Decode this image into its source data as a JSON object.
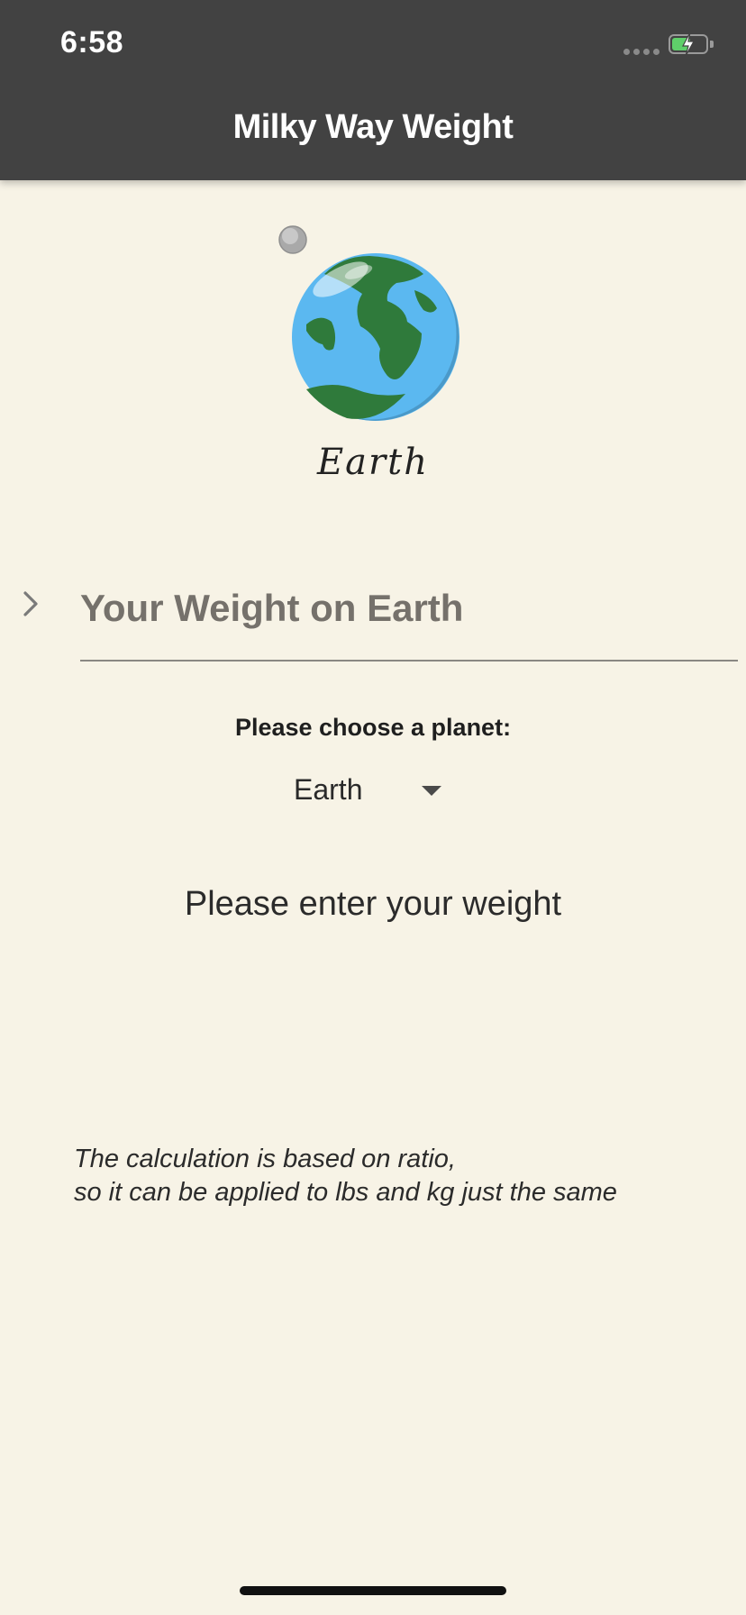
{
  "status_bar": {
    "time": "6:58",
    "battery_icon": "battery-charging-icon",
    "signal_icon": "signal-dots-icon"
  },
  "app_bar": {
    "title": "Milky Way Weight"
  },
  "planet": {
    "name": "Earth",
    "icon": "earth-planet-icon"
  },
  "weight_field": {
    "placeholder": "Your Weight on Earth",
    "value": "",
    "icon": "chevron-right-icon"
  },
  "planet_picker": {
    "label": "Please choose a planet:",
    "selected": "Earth"
  },
  "result": {
    "text": "Please enter your weight"
  },
  "note": {
    "line1": "The calculation is based on ratio,",
    "line2": "so it can be applied to lbs and kg just the same"
  },
  "colors": {
    "app_bar": "#424242",
    "background": "#f7f3e6",
    "accent_text": "#75716b"
  }
}
